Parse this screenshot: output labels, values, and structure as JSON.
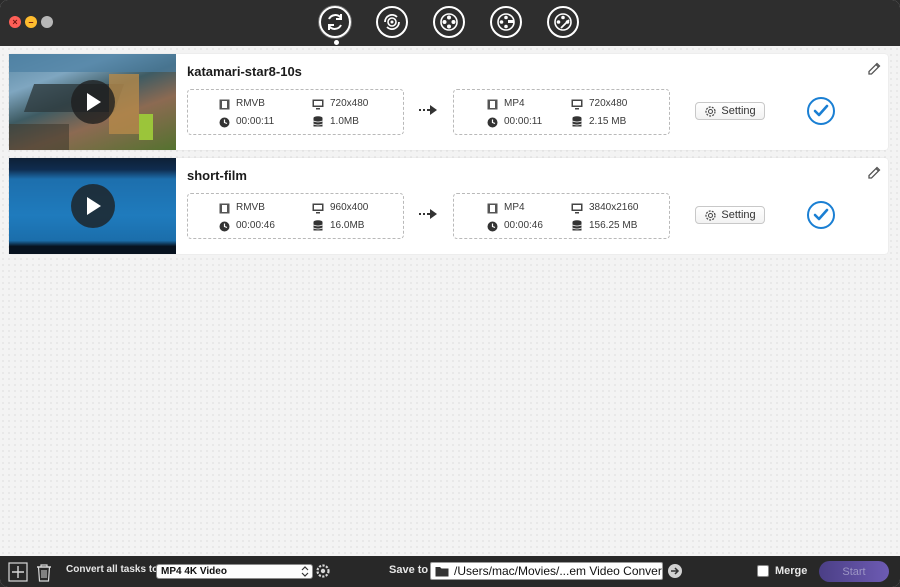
{
  "titlebar": {
    "modes": [
      {
        "name": "convert-mode-icon"
      },
      {
        "name": "rotate-mode-icon"
      },
      {
        "name": "film-reel-add-icon"
      },
      {
        "name": "film-reel-edit-icon"
      },
      {
        "name": "film-reel-tools-icon"
      }
    ],
    "traffic_close_glyph": "×",
    "traffic_min_glyph": "–"
  },
  "tasks": [
    {
      "name": "katamari-star8-10s",
      "source": {
        "format": "RMVB",
        "resolution": "720x480",
        "duration": "00:00:11",
        "size": "1.0MB"
      },
      "target": {
        "format": "MP4",
        "resolution": "720x480",
        "duration": "00:00:11",
        "size": "2.15 MB"
      },
      "setting_label": "Setting"
    },
    {
      "name": "short-film",
      "source": {
        "format": "RMVB",
        "resolution": "960x400",
        "duration": "00:00:46",
        "size": "16.0MB"
      },
      "target": {
        "format": "MP4",
        "resolution": "3840x2160",
        "duration": "00:00:46",
        "size": "156.25 MB"
      },
      "setting_label": "Setting"
    }
  ],
  "bottombar": {
    "convert_all_label": "Convert all tasks to",
    "convert_all_value": "MP4 4K Video",
    "save_to_label": "Save to",
    "save_path": "/Users/mac/Movies/...em Video Converter",
    "merge_label": "Merge",
    "start_label": "Start"
  },
  "colors": {
    "accent": "#1a7fd3",
    "titlebar_bg": "#2e2e2e",
    "start_button": "#5a4a9e"
  }
}
